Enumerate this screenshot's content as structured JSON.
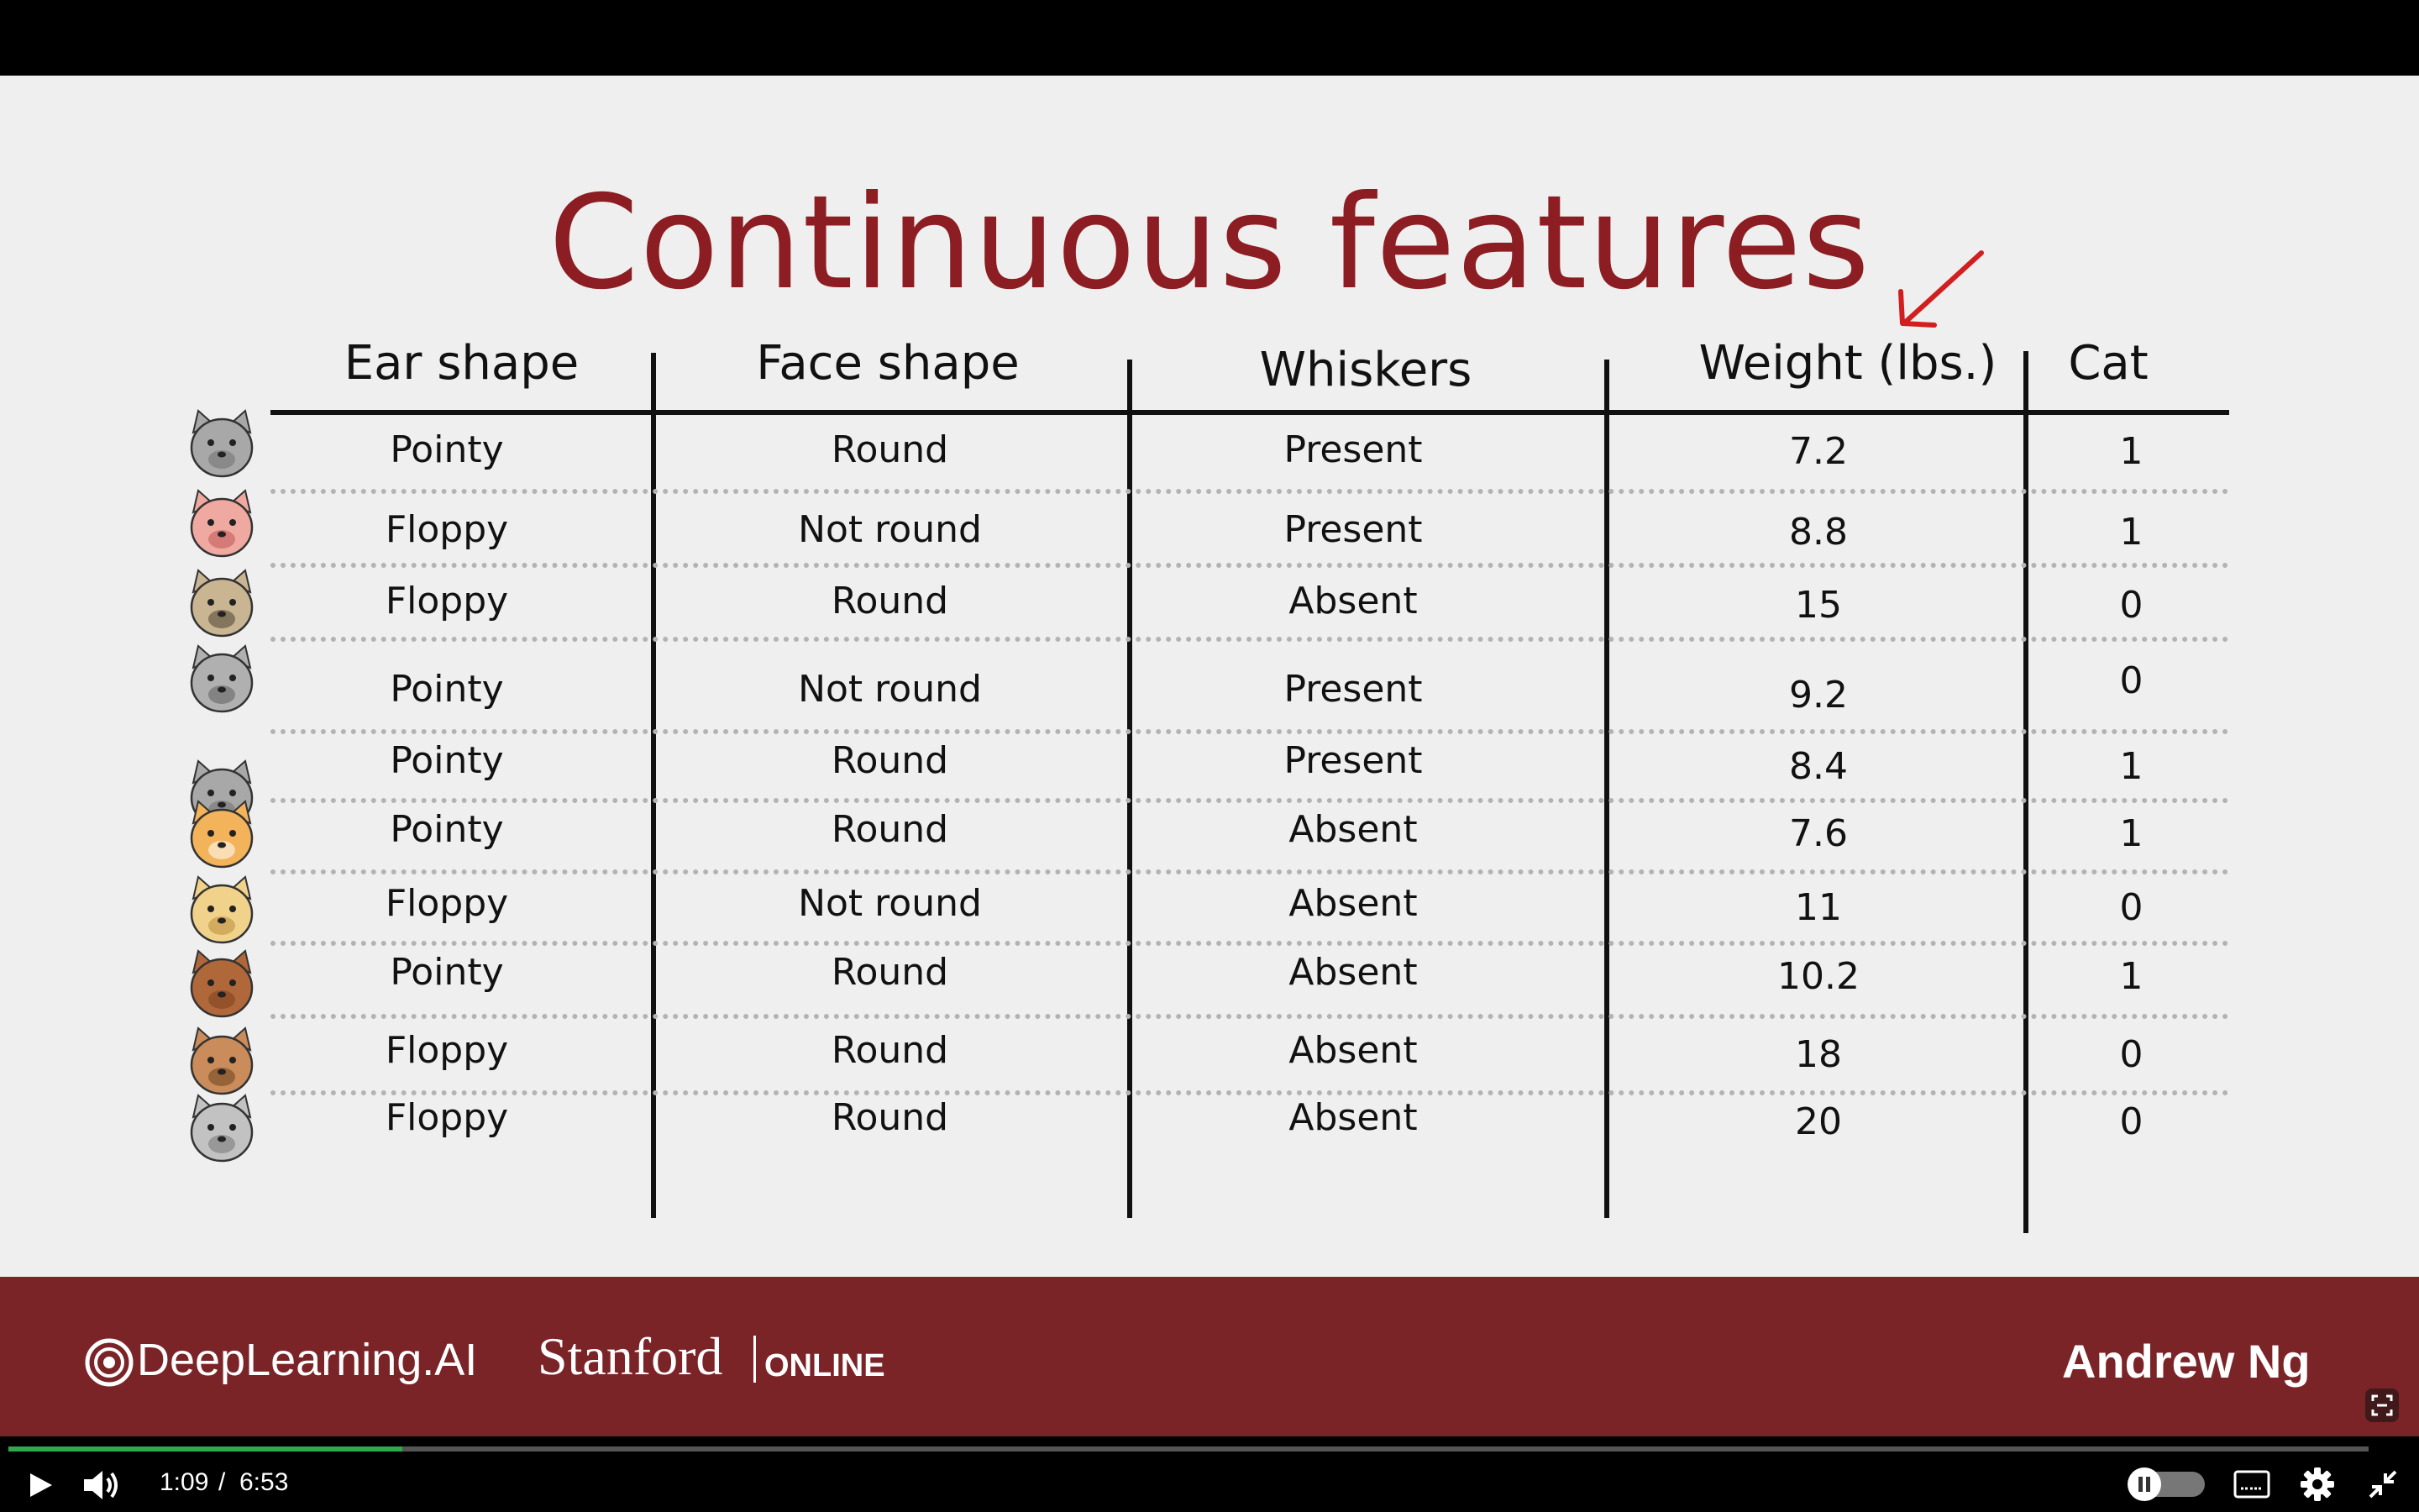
{
  "slide": {
    "title": "Continuous features",
    "columns": [
      "Ear shape",
      "Face shape",
      "Whiskers",
      "Weight (lbs.)",
      "Cat"
    ],
    "rows": [
      {
        "ear": "Pointy",
        "face": "Round",
        "whiskers": "Present",
        "weight": "7.2",
        "cat": "1"
      },
      {
        "ear": "Floppy",
        "face": "Not round",
        "whiskers": "Present",
        "weight": "8.8",
        "cat": "1"
      },
      {
        "ear": "Floppy",
        "face": "Round",
        "whiskers": "Absent",
        "weight": "15",
        "cat": "0"
      },
      {
        "ear": "Pointy",
        "face": "Not round",
        "whiskers": "Present",
        "weight": "9.2",
        "cat": "0"
      },
      {
        "ear": "Pointy",
        "face": "Round",
        "whiskers": "Present",
        "weight": "8.4",
        "cat": "1"
      },
      {
        "ear": "Pointy",
        "face": "Round",
        "whiskers": "Absent",
        "weight": "7.6",
        "cat": "1"
      },
      {
        "ear": "Floppy",
        "face": "Not round",
        "whiskers": "Absent",
        "weight": "11",
        "cat": "0"
      },
      {
        "ear": "Pointy",
        "face": "Round",
        "whiskers": "Absent",
        "weight": "10.2",
        "cat": "1"
      },
      {
        "ear": "Floppy",
        "face": "Round",
        "whiskers": "Absent",
        "weight": "18",
        "cat": "0"
      },
      {
        "ear": "Floppy",
        "face": "Round",
        "whiskers": "Absent",
        "weight": "20",
        "cat": "0"
      }
    ],
    "animal_icons": [
      "gray-cat-icon",
      "pink-cat-icon",
      "pug-dog-icon",
      "gray-wolf-dog-icon",
      "gray-cat-icon",
      "orange-cat-icon",
      "yellow-dog-icon",
      "brown-cat-icon",
      "brown-dog-icon",
      "gray-dog-icon"
    ]
  },
  "footer": {
    "brand1": "DeepLearning.AI",
    "brand2_main": "Stanford",
    "brand2_sub": "ONLINE",
    "presenter": "Andrew Ng"
  },
  "player": {
    "current_time": "1:09",
    "separator": "/",
    "duration": "6:53",
    "progress_fraction": 0.167
  },
  "colors": {
    "title": "#8c1d22",
    "footer_bg": "#7b2428",
    "progress": "#2eaa4a"
  }
}
